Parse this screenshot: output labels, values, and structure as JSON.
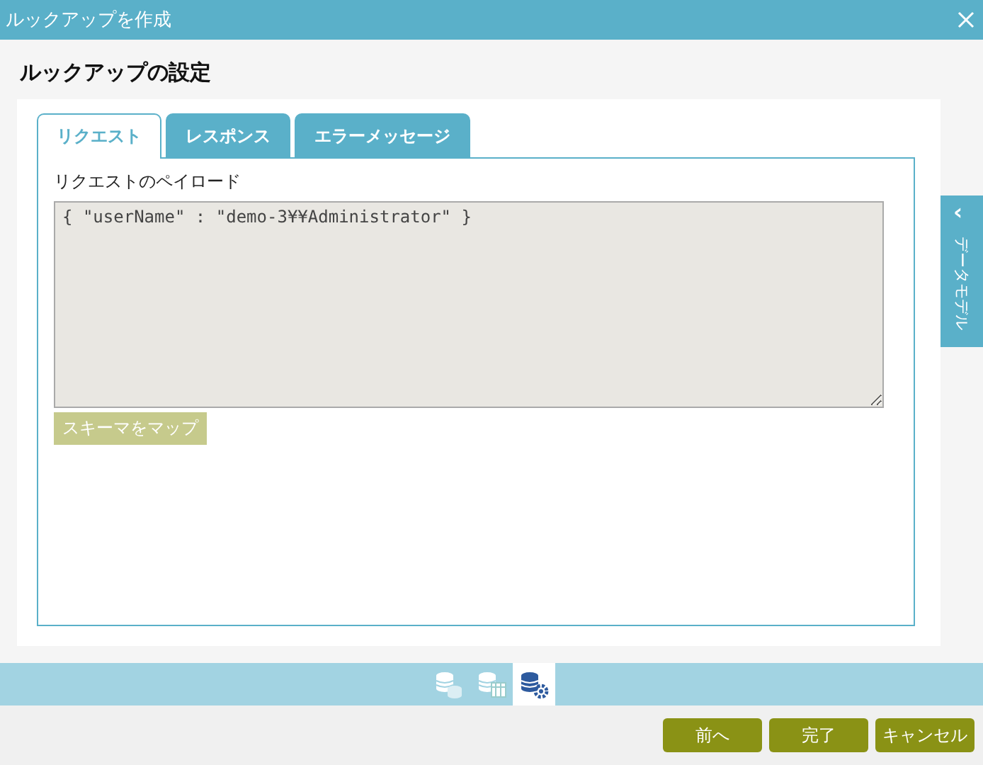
{
  "window": {
    "title": "ルックアップを作成"
  },
  "heading": "ルックアップの設定",
  "tabs": [
    {
      "label": "リクエスト",
      "selected": true
    },
    {
      "label": "レスポンス",
      "selected": false
    },
    {
      "label": "エラーメッセージ",
      "selected": false
    }
  ],
  "payload": {
    "label": "リクエストのペイロード",
    "value": "{ \"userName\" : \"demo-3¥¥Administrator\" }"
  },
  "map_button": {
    "label": "スキーマをマップ",
    "disabled": true
  },
  "side_panel": {
    "label": "データモデル",
    "collapse_icon": "‹"
  },
  "view_icons": [
    {
      "kind": "data",
      "selected": false
    },
    {
      "kind": "table",
      "selected": false
    },
    {
      "kind": "settings",
      "selected": true
    }
  ],
  "buttons": [
    "前へ",
    "完了",
    "キャンセル"
  ]
}
